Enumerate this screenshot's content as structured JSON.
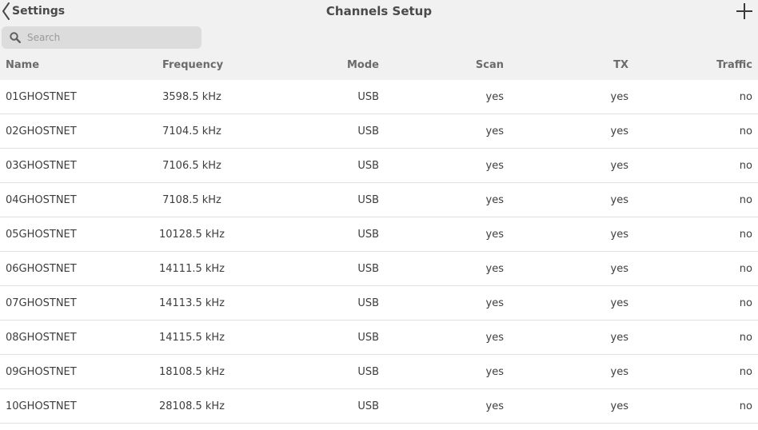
{
  "nav": {
    "back_label": "Settings",
    "title": "Channels Setup"
  },
  "search": {
    "placeholder": "Search",
    "value": ""
  },
  "columns": {
    "name": "Name",
    "frequency": "Frequency",
    "mode": "Mode",
    "scan": "Scan",
    "tx": "TX",
    "traffic": "Traffic"
  },
  "rows": [
    {
      "name": "01GHOSTNET",
      "frequency": "3598.5 kHz",
      "mode": "USB",
      "scan": "yes",
      "tx": "yes",
      "traffic": "no"
    },
    {
      "name": "02GHOSTNET",
      "frequency": "7104.5 kHz",
      "mode": "USB",
      "scan": "yes",
      "tx": "yes",
      "traffic": "no"
    },
    {
      "name": "03GHOSTNET",
      "frequency": "7106.5 kHz",
      "mode": "USB",
      "scan": "yes",
      "tx": "yes",
      "traffic": "no"
    },
    {
      "name": "04GHOSTNET",
      "frequency": "7108.5 kHz",
      "mode": "USB",
      "scan": "yes",
      "tx": "yes",
      "traffic": "no"
    },
    {
      "name": "05GHOSTNET",
      "frequency": "10128.5 kHz",
      "mode": "USB",
      "scan": "yes",
      "tx": "yes",
      "traffic": "no"
    },
    {
      "name": "06GHOSTNET",
      "frequency": "14111.5 kHz",
      "mode": "USB",
      "scan": "yes",
      "tx": "yes",
      "traffic": "no"
    },
    {
      "name": "07GHOSTNET",
      "frequency": "14113.5 kHz",
      "mode": "USB",
      "scan": "yes",
      "tx": "yes",
      "traffic": "no"
    },
    {
      "name": "08GHOSTNET",
      "frequency": "14115.5 kHz",
      "mode": "USB",
      "scan": "yes",
      "tx": "yes",
      "traffic": "no"
    },
    {
      "name": "09GHOSTNET",
      "frequency": "18108.5 kHz",
      "mode": "USB",
      "scan": "yes",
      "tx": "yes",
      "traffic": "no"
    },
    {
      "name": "10GHOSTNET",
      "frequency": "28108.5 kHz",
      "mode": "USB",
      "scan": "yes",
      "tx": "yes",
      "traffic": "no"
    }
  ],
  "icons": {
    "back": "chevron-left-icon",
    "add": "plus-icon",
    "search": "search-icon"
  },
  "colors": {
    "header_background": "#f1f1f1",
    "search_background": "#dcdcdc",
    "row_divider": "#e0e0e0"
  }
}
